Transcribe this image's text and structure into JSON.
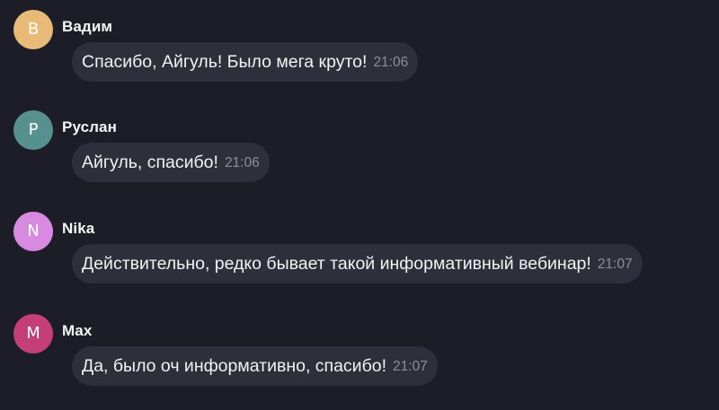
{
  "messages": [
    {
      "avatar_letter": "В",
      "avatar_color": "#e8b977",
      "sender": "Вадим",
      "text": "Спасибо, Айгуль! Было мега круто!",
      "time": "21:06"
    },
    {
      "avatar_letter": "Р",
      "avatar_color": "#56918f",
      "sender": "Руслан",
      "text": "Айгуль, спасибо!",
      "time": "21:06"
    },
    {
      "avatar_letter": "N",
      "avatar_color": "#d78ae0",
      "sender": "Nika",
      "text": "Действительно, редко бывает такой информативный вебинар!",
      "time": "21:07"
    },
    {
      "avatar_letter": "M",
      "avatar_color": "#c43f77",
      "sender": "Max",
      "text": "Да, было оч информативно, спасибо!",
      "time": "21:07"
    }
  ]
}
